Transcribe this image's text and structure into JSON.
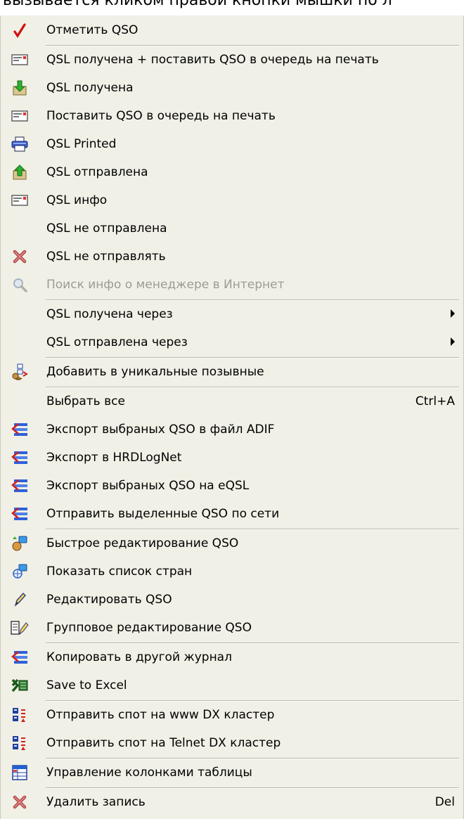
{
  "top_caption": "вызывается кликом правой кнопки мышки по л",
  "menu": {
    "items": [
      {
        "label": "Отметить QSO",
        "icon": "check-mark-icon"
      },
      {
        "label": "QSL получена + поставить QSO в очередь на печать",
        "icon": "qsl-card-icon"
      },
      {
        "label": "QSL получена",
        "icon": "received-down-arrow-icon"
      },
      {
        "label": "Поставить QSO в очередь на печать",
        "icon": "qsl-card-icon"
      },
      {
        "label": "QSL Printed",
        "icon": "printer-icon"
      },
      {
        "label": "QSL отправлена",
        "icon": "sent-up-arrow-icon"
      },
      {
        "label": "QSL инфо",
        "icon": "qsl-card-icon"
      },
      {
        "label": "QSL не отправлена",
        "icon": ""
      },
      {
        "label": "QSL не отправлять",
        "icon": "delete-x-icon"
      },
      {
        "label": "Поиск инфо о менеджере в Интернет",
        "icon": "search-magnifier-icon",
        "disabled": true
      },
      {
        "label": "QSL получена через",
        "submenu": true
      },
      {
        "label": "QSL отправлена через",
        "submenu": true
      },
      {
        "label": "Добавить в уникальные позывные",
        "icon": "add-unique-callsign-icon"
      },
      {
        "label": "Выбрать все",
        "shortcut": "Ctrl+A"
      },
      {
        "label": "Экспорт выбраных QSO в файл ADIF",
        "icon": "export-icon"
      },
      {
        "label": "Экспорт в HRDLogNet",
        "icon": "export-icon"
      },
      {
        "label": "Экспорт выбраных QSO на eQSL",
        "icon": "export-icon"
      },
      {
        "label": "Отправить выделенные QSO по сети",
        "icon": "export-icon"
      },
      {
        "label": "Быстрое редактирование QSO",
        "icon": "quick-edit-icon"
      },
      {
        "label": "Показать список стран",
        "icon": "country-list-icon"
      },
      {
        "label": "Редактировать QSO",
        "icon": "pencil-icon"
      },
      {
        "label": "Групповое редактирование QSO",
        "icon": "group-edit-icon"
      },
      {
        "label": "Копировать в другой журнал",
        "icon": "export-icon"
      },
      {
        "label": "Save to Excel",
        "icon": "excel-icon"
      },
      {
        "label": "Отправить спот на www DX кластер",
        "icon": "dx-cluster-icon"
      },
      {
        "label": "Отправить спот на Telnet DX кластер",
        "icon": "dx-cluster-icon"
      },
      {
        "label": "Управление колонками таблицы",
        "icon": "table-columns-icon"
      },
      {
        "label": "Удалить запись",
        "icon": "delete-x-icon",
        "shortcut": "Del"
      }
    ]
  },
  "colors": {
    "menu_bg": "#f0f0e6",
    "separator": "#b7b7ac",
    "disabled_text": "#9c9c94"
  }
}
